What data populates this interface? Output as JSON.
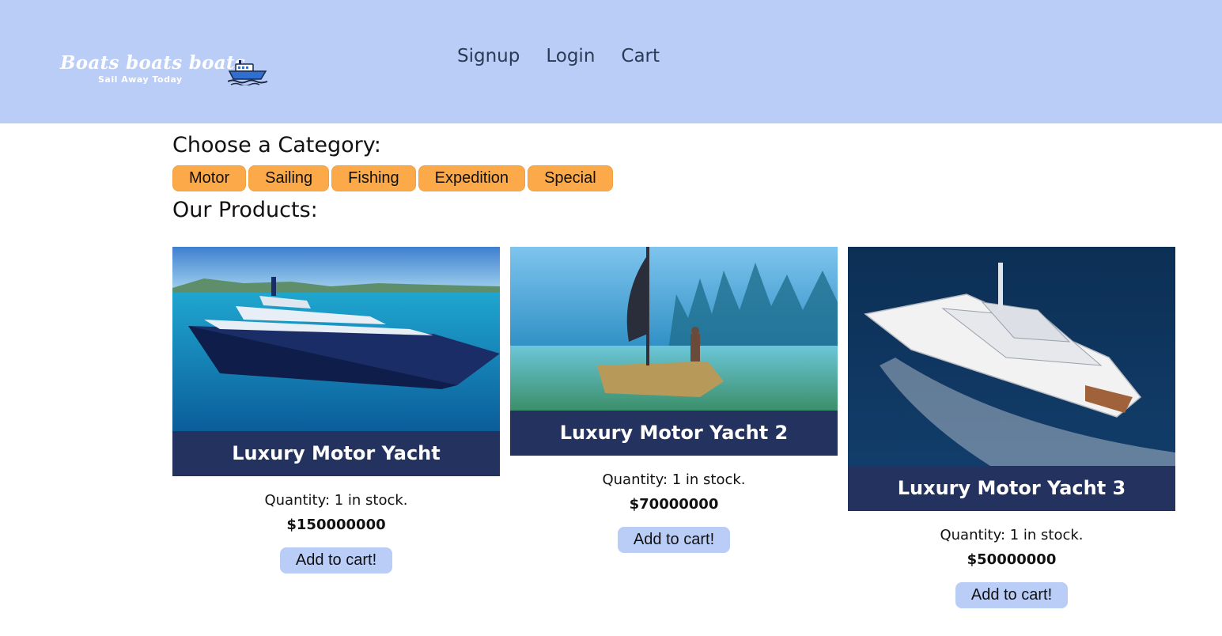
{
  "header": {
    "logo_title": "Boats boats boats",
    "logo_subtitle": "Sail Away Today",
    "nav": [
      {
        "label": "Signup"
      },
      {
        "label": "Login"
      },
      {
        "label": "Cart"
      }
    ]
  },
  "categories": {
    "heading": "Choose a Category:",
    "items": [
      {
        "label": "Motor"
      },
      {
        "label": "Sailing"
      },
      {
        "label": "Fishing"
      },
      {
        "label": "Expedition"
      },
      {
        "label": "Special"
      }
    ]
  },
  "products": {
    "heading": "Our Products:",
    "items": [
      {
        "title": "Luxury Motor Yacht",
        "quantity": "Quantity: 1 in stock.",
        "price": "$150000000",
        "button": "Add to cart!"
      },
      {
        "title": "Luxury Motor Yacht 2",
        "quantity": "Quantity: 1 in stock.",
        "price": "$70000000",
        "button": "Add to cart!"
      },
      {
        "title": "Luxury Motor Yacht 3",
        "quantity": "Quantity: 1 in stock.",
        "price": "$50000000",
        "button": "Add to cart!"
      }
    ]
  },
  "colors": {
    "header_bg": "#bacdf6",
    "category_button": "#fca94a",
    "card_title_bg": "#23325e",
    "add_button": "#bacdf6"
  }
}
